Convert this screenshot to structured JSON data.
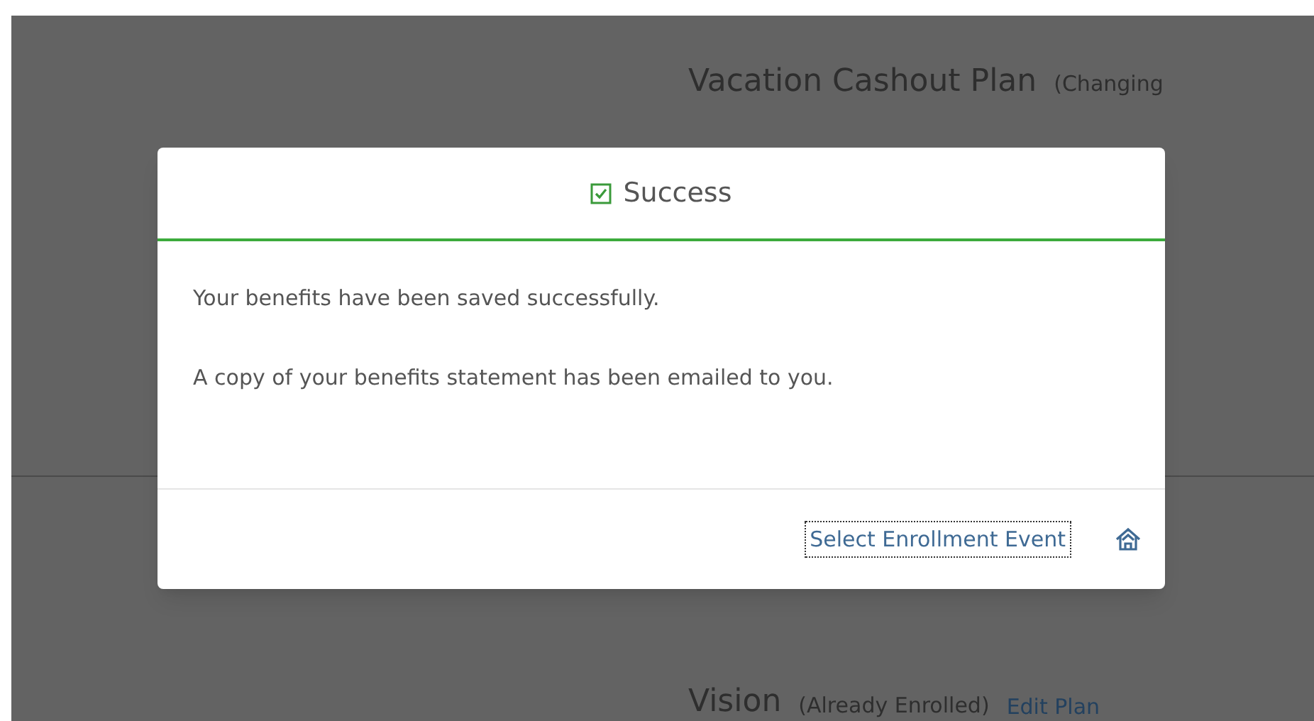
{
  "background": {
    "plans": [
      {
        "name": "Vacation Cashout Plan",
        "status": "(Changing"
      },
      {
        "name": "Vision",
        "status": "(Already Enrolled)",
        "link": "Edit Plan"
      }
    ]
  },
  "dialog": {
    "title": "Success",
    "messages": [
      "Your benefits have been saved successfully.",
      "A copy of your benefits statement has been emailed to you."
    ],
    "action": "Select Enrollment Event",
    "focused": true
  }
}
